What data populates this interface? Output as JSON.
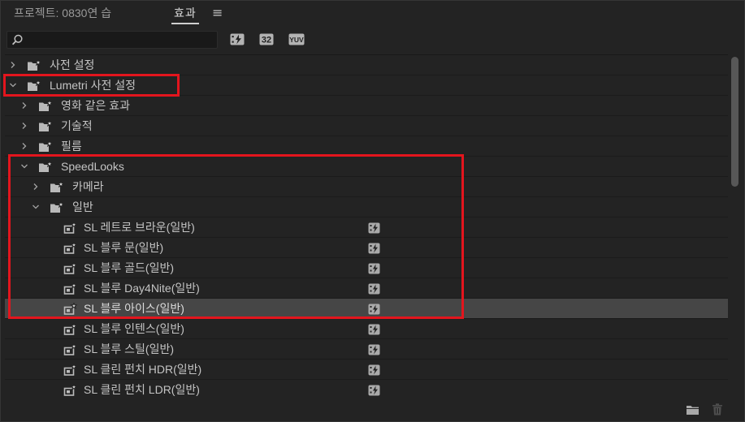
{
  "colors": {
    "panel_bg": "#232323",
    "text": "#c4c4c4",
    "selected_row": "#464646",
    "annotation": "#e3151d"
  },
  "tabs": [
    {
      "label": "프로젝트: 0830연 습",
      "active": false
    },
    {
      "label": "효과",
      "active": true
    }
  ],
  "panel_menu": {
    "label": "≡",
    "icon": "hamburger-menu-icon"
  },
  "search": {
    "value": "",
    "placeholder": "",
    "icon": "search-icon"
  },
  "filter_buttons": [
    {
      "icon": "accelerated-effects-icon"
    },
    {
      "icon": "32-bit-color-icon",
      "label": "32"
    },
    {
      "icon": "yuv-effects-icon",
      "label": "YUV"
    }
  ],
  "tree": [
    {
      "label": "사전 설정",
      "type": "folder",
      "icon": "preset-folder-icon",
      "level": 0,
      "expanded": false
    },
    {
      "label": "Lumetri 사전 설정",
      "type": "folder",
      "icon": "preset-folder-icon",
      "level": 0,
      "expanded": true
    },
    {
      "label": "영화 같은 효과",
      "type": "folder",
      "icon": "preset-folder-icon",
      "level": 1,
      "expanded": false
    },
    {
      "label": "기술적",
      "type": "folder",
      "icon": "preset-folder-icon",
      "level": 1,
      "expanded": false
    },
    {
      "label": "필름",
      "type": "folder",
      "icon": "preset-folder-icon",
      "level": 1,
      "expanded": false
    },
    {
      "label": "SpeedLooks",
      "type": "folder",
      "icon": "preset-folder-icon",
      "level": 1,
      "expanded": true
    },
    {
      "label": "카메라",
      "type": "folder",
      "icon": "preset-folder-icon",
      "level": 2,
      "expanded": false
    },
    {
      "label": "일반",
      "type": "folder",
      "icon": "preset-folder-icon",
      "level": 2,
      "expanded": true
    },
    {
      "label": "SL 레트로 브라운(일반)",
      "type": "preset",
      "icon": "effect-preset-icon",
      "level": 3,
      "accelerated": true
    },
    {
      "label": "SL 블루 문(일반)",
      "type": "preset",
      "icon": "effect-preset-icon",
      "level": 3,
      "accelerated": true
    },
    {
      "label": "SL 블루 골드(일반)",
      "type": "preset",
      "icon": "effect-preset-icon",
      "level": 3,
      "accelerated": true
    },
    {
      "label": "SL 블루 Day4Nite(일반)",
      "type": "preset",
      "icon": "effect-preset-icon",
      "level": 3,
      "accelerated": true
    },
    {
      "label": "SL 블루 아이스(일반)",
      "type": "preset",
      "icon": "effect-preset-icon",
      "level": 3,
      "accelerated": true,
      "selected": true
    },
    {
      "label": "SL 블루 인텐스(일반)",
      "type": "preset",
      "icon": "effect-preset-icon",
      "level": 3,
      "accelerated": true
    },
    {
      "label": "SL 블루 스틸(일반)",
      "type": "preset",
      "icon": "effect-preset-icon",
      "level": 3,
      "accelerated": true
    },
    {
      "label": "SL 클린 펀치 HDR(일반)",
      "type": "preset",
      "icon": "effect-preset-icon",
      "level": 3,
      "accelerated": true
    },
    {
      "label": "SL 클린 펀치 LDR(일반)",
      "type": "preset",
      "icon": "effect-preset-icon",
      "level": 3,
      "accelerated": true
    }
  ],
  "accelerated_badge_icon": "accelerated-effect-icon",
  "footer": {
    "new_bin_icon": "new-bin-icon",
    "delete_icon": "trash-icon"
  }
}
